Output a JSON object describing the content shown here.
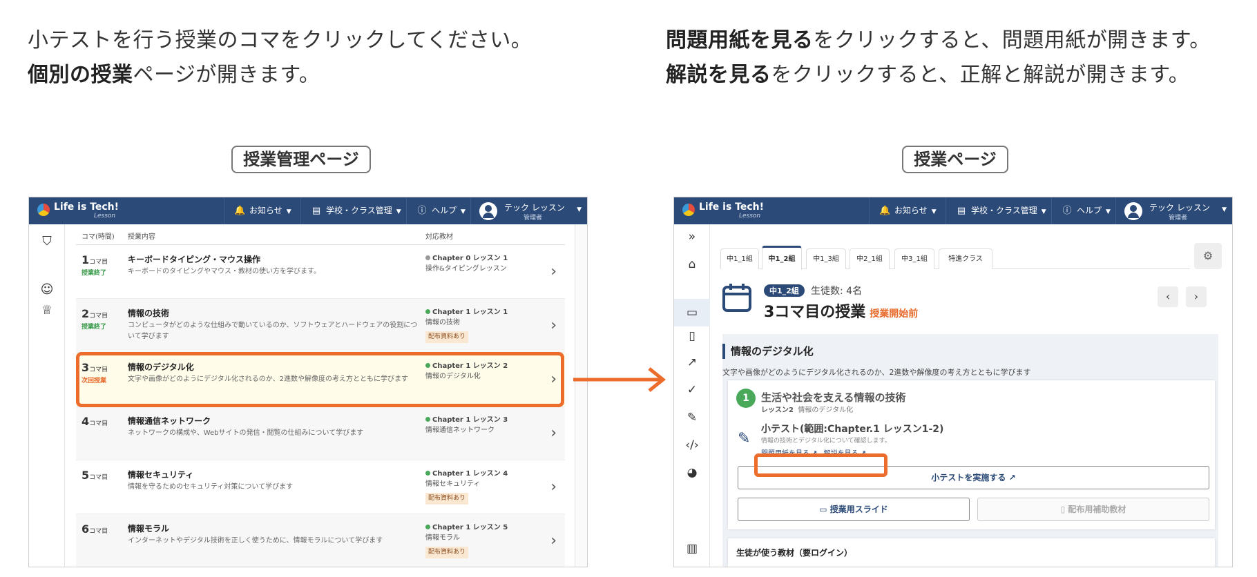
{
  "instructions": {
    "left_line1": "小テストを行う授業のコマをクリックしてください。",
    "left_line2_bold": "個別の授業",
    "left_line2_rest": "ページが開きます。",
    "right_line1_bold": "問題用紙を見る",
    "right_line1_rest": "をクリックすると、問題用紙が開きます。",
    "right_line2_bold": "解説を見る",
    "right_line2_rest": "をクリックすると、正解と解説が開きます。"
  },
  "labels": {
    "manage_page": "授業管理ページ",
    "lesson_page": "授業ページ"
  },
  "colors": {
    "nav": "#2b4a78",
    "highlight": "#ec6c2c",
    "done": "#3a9a4a",
    "next": "#e86a2b"
  },
  "nav": {
    "logo_text": "Life is Tech!",
    "logo_sub": "Lesson",
    "notice": "お知らせ",
    "school": "学校・クラス管理",
    "help": "ヘルプ",
    "user_name": "テック レッスン",
    "user_role": "管理者"
  },
  "manage": {
    "headers": {
      "koma": "コマ(時間)",
      "content": "授業内容",
      "material": "対応教材"
    },
    "koma_unit": "コマ目",
    "rows": [
      {
        "num": "1",
        "status": "授業終了",
        "status_type": "done",
        "title": "キーボードタイピング・マウス操作",
        "desc": "キーボードのタイピングやマウス・教材の使い方を学びます。",
        "chapter": "Chapter 0 レッスン 1",
        "dot": "#999999",
        "sub": "操作&タイピングレッスン",
        "badge": ""
      },
      {
        "num": "2",
        "status": "授業終了",
        "status_type": "done",
        "title": "情報の技術",
        "desc": "コンピュータがどのような仕組みで動いているのか、ソフトウェアとハードウェアの役割について学びます",
        "chapter": "Chapter 1 レッスン 1",
        "dot": "#4aa85a",
        "sub": "情報の技術",
        "badge": "配布資料あり"
      },
      {
        "num": "3",
        "status": "次回授業",
        "status_type": "next",
        "title": "情報のデジタル化",
        "desc": "文字や画像がどのようにデジタル化されるのか、2進数や解像度の考え方とともに学びます",
        "chapter": "Chapter 1 レッスン 2",
        "dot": "#4aa85a",
        "sub": "情報のデジタル化",
        "badge": ""
      },
      {
        "num": "4",
        "status": "",
        "status_type": "",
        "title": "情報通信ネットワーク",
        "desc": "ネットワークの構成や、Webサイトの発信・閲覧の仕組みについて学びます",
        "chapter": "Chapter 1 レッスン 3",
        "dot": "#4aa85a",
        "sub": "情報通信ネットワーク",
        "badge": ""
      },
      {
        "num": "5",
        "status": "",
        "status_type": "",
        "title": "情報セキュリティ",
        "desc": "情報を守るためのセキュリティ対策について学びます",
        "chapter": "Chapter 1 レッスン 4",
        "dot": "#4aa85a",
        "sub": "情報セキュリティ",
        "badge": "配布資料あり"
      },
      {
        "num": "6",
        "status": "",
        "status_type": "",
        "title": "情報モラル",
        "desc": "インターネットやデジタル技術を正しく使うために、情報モラルについて学びます",
        "chapter": "Chapter 1 レッスン 5",
        "dot": "#4aa85a",
        "sub": "情報モラル",
        "badge": "配布資料あり"
      }
    ]
  },
  "lesson": {
    "tabs": [
      "中1_1組",
      "中1_2組",
      "中1_3組",
      "中2_1組",
      "中3_1組",
      "特進クラス"
    ],
    "active_tab": "中1_2組",
    "class_badge": "中1_2組",
    "student_count": "生徒数: 4名",
    "title": "3コマ目の授業",
    "state": "授業開始前",
    "section_title": "情報のデジタル化",
    "section_desc": "文字や画像がどのようにデジタル化されるのか、2進数や解像度の考え方とともに学びます",
    "chapter_num": "1",
    "chapter_title": "生活や社会を支える情報の技術",
    "chapter_sub_bold": "レッスン2",
    "chapter_sub_rest": "情報のデジタル化",
    "quiz_title": "小テスト(範囲:Chapter.1 レッスン1-2)",
    "quiz_desc": "情報の技術とデジタル化について確認します。",
    "link_questions": "問題用紙を見る",
    "link_answers": "解説を見る",
    "btn_quiz": "小テストを実施する",
    "btn_slides": "授業用スライド",
    "btn_materials": "配布用補助教材",
    "student_section": "生徒が使う教材（要ログイン）"
  }
}
